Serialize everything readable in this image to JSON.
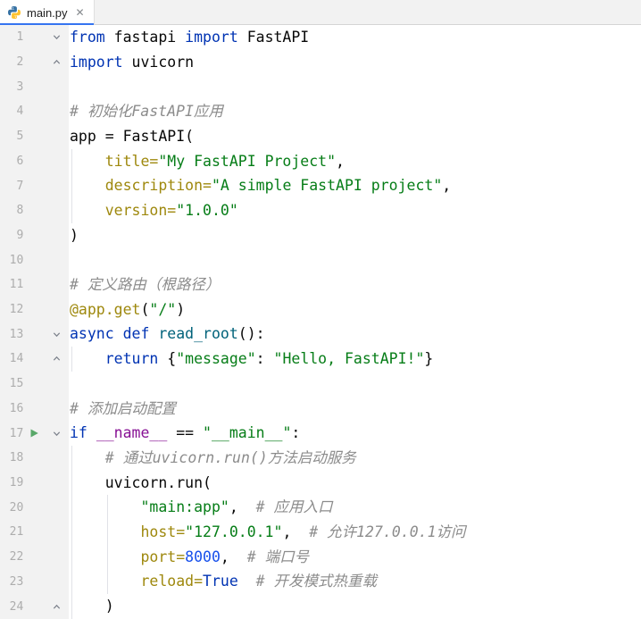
{
  "tab_bar": {
    "tab": {
      "label": "main.py",
      "close_label": "✕",
      "selected": true,
      "icon": "python-icon"
    }
  },
  "colors": {
    "keyword": "#0033B3",
    "string": "#067D17",
    "number": "#1750EB",
    "comment": "#8C8C8C",
    "decorator": "#9E880D",
    "kwarg": "#9E880D",
    "function": "#00627A",
    "dunder": "#871094",
    "plain": "#080808",
    "line_number": "#ADADAD",
    "run_arrow": "#59A869",
    "tab_underline": "#3574F0",
    "gutter_bg": "#F2F2F2",
    "editor_bg": "#FFFFFF"
  },
  "editor": {
    "lines": [
      {
        "n": 1,
        "fold": "start",
        "tokens": [
          [
            "from",
            "kw"
          ],
          [
            " fastapi ",
            "pl"
          ],
          [
            "import",
            "kw"
          ],
          [
            " FastAPI",
            "pl"
          ]
        ]
      },
      {
        "n": 2,
        "fold": "end",
        "tokens": [
          [
            "import",
            "kw"
          ],
          [
            " uvicorn",
            "pl"
          ]
        ]
      },
      {
        "n": 3,
        "tokens": []
      },
      {
        "n": 4,
        "tokens": [
          [
            "# 初始化FastAPI应用",
            "cm"
          ]
        ]
      },
      {
        "n": 5,
        "tokens": [
          [
            "app = FastAPI(",
            "pl"
          ]
        ]
      },
      {
        "n": 6,
        "guides": [
          0
        ],
        "tokens": [
          [
            "    ",
            "pl"
          ],
          [
            "title=",
            "arg"
          ],
          [
            "\"My FastAPI Project\"",
            "str"
          ],
          [
            ",",
            "pl"
          ]
        ]
      },
      {
        "n": 7,
        "guides": [
          0
        ],
        "tokens": [
          [
            "    ",
            "pl"
          ],
          [
            "description=",
            "arg"
          ],
          [
            "\"A simple FastAPI project\"",
            "str"
          ],
          [
            ",",
            "pl"
          ]
        ]
      },
      {
        "n": 8,
        "guides": [
          0
        ],
        "tokens": [
          [
            "    ",
            "pl"
          ],
          [
            "version=",
            "arg"
          ],
          [
            "\"1.0.0\"",
            "str"
          ]
        ]
      },
      {
        "n": 9,
        "tokens": [
          [
            ")",
            "pl"
          ]
        ]
      },
      {
        "n": 10,
        "tokens": []
      },
      {
        "n": 11,
        "tokens": [
          [
            "# 定义路由（根路径）",
            "cm"
          ]
        ]
      },
      {
        "n": 12,
        "tokens": [
          [
            "@app.get",
            "deco"
          ],
          [
            "(",
            "pl"
          ],
          [
            "\"/\"",
            "str"
          ],
          [
            ")",
            "pl"
          ]
        ]
      },
      {
        "n": 13,
        "fold": "start",
        "tokens": [
          [
            "async",
            "kw"
          ],
          [
            " ",
            "pl"
          ],
          [
            "def",
            "kw"
          ],
          [
            " ",
            "pl"
          ],
          [
            "read_root",
            "fn"
          ],
          [
            "():",
            "pl"
          ]
        ]
      },
      {
        "n": 14,
        "fold": "end",
        "guides": [
          0
        ],
        "tokens": [
          [
            "    ",
            "pl"
          ],
          [
            "return",
            "kw"
          ],
          [
            " {",
            "pl"
          ],
          [
            "\"message\"",
            "str"
          ],
          [
            ": ",
            "pl"
          ],
          [
            "\"Hello, FastAPI!\"",
            "str"
          ],
          [
            "}",
            "pl"
          ]
        ]
      },
      {
        "n": 15,
        "tokens": []
      },
      {
        "n": 16,
        "tokens": [
          [
            "# 添加启动配置",
            "cm"
          ]
        ]
      },
      {
        "n": 17,
        "fold": "start",
        "run": true,
        "tokens": [
          [
            "if",
            "kw"
          ],
          [
            " ",
            "pl"
          ],
          [
            "__name__",
            "dn"
          ],
          [
            " == ",
            "pl"
          ],
          [
            "\"__main__\"",
            "str"
          ],
          [
            ":",
            "pl"
          ]
        ]
      },
      {
        "n": 18,
        "guides": [
          0
        ],
        "tokens": [
          [
            "    ",
            "pl"
          ],
          [
            "# 通过uvicorn.run()方法启动服务",
            "cm"
          ]
        ]
      },
      {
        "n": 19,
        "guides": [
          0
        ],
        "tokens": [
          [
            "    uvicorn.run(",
            "pl"
          ]
        ]
      },
      {
        "n": 20,
        "guides": [
          0,
          4
        ],
        "tokens": [
          [
            "        ",
            "pl"
          ],
          [
            "\"main:app\"",
            "str"
          ],
          [
            ",  ",
            "pl"
          ],
          [
            "# 应用入口",
            "cm"
          ]
        ]
      },
      {
        "n": 21,
        "guides": [
          0,
          4
        ],
        "tokens": [
          [
            "        ",
            "pl"
          ],
          [
            "host=",
            "arg"
          ],
          [
            "\"127.0.0.1\"",
            "str"
          ],
          [
            ",  ",
            "pl"
          ],
          [
            "# 允许127.0.0.1访问",
            "cm"
          ]
        ]
      },
      {
        "n": 22,
        "guides": [
          0,
          4
        ],
        "tokens": [
          [
            "        ",
            "pl"
          ],
          [
            "port=",
            "arg"
          ],
          [
            "8000",
            "num"
          ],
          [
            ",  ",
            "pl"
          ],
          [
            "# 端口号",
            "cm"
          ]
        ]
      },
      {
        "n": 23,
        "guides": [
          0,
          4
        ],
        "tokens": [
          [
            "        ",
            "pl"
          ],
          [
            "reload=",
            "arg"
          ],
          [
            "True",
            "kw"
          ],
          [
            "  ",
            "pl"
          ],
          [
            "# 开发模式热重载",
            "cm"
          ]
        ]
      },
      {
        "n": 24,
        "fold": "end",
        "guides": [
          0
        ],
        "tokens": [
          [
            "    )",
            "pl"
          ]
        ]
      }
    ]
  }
}
